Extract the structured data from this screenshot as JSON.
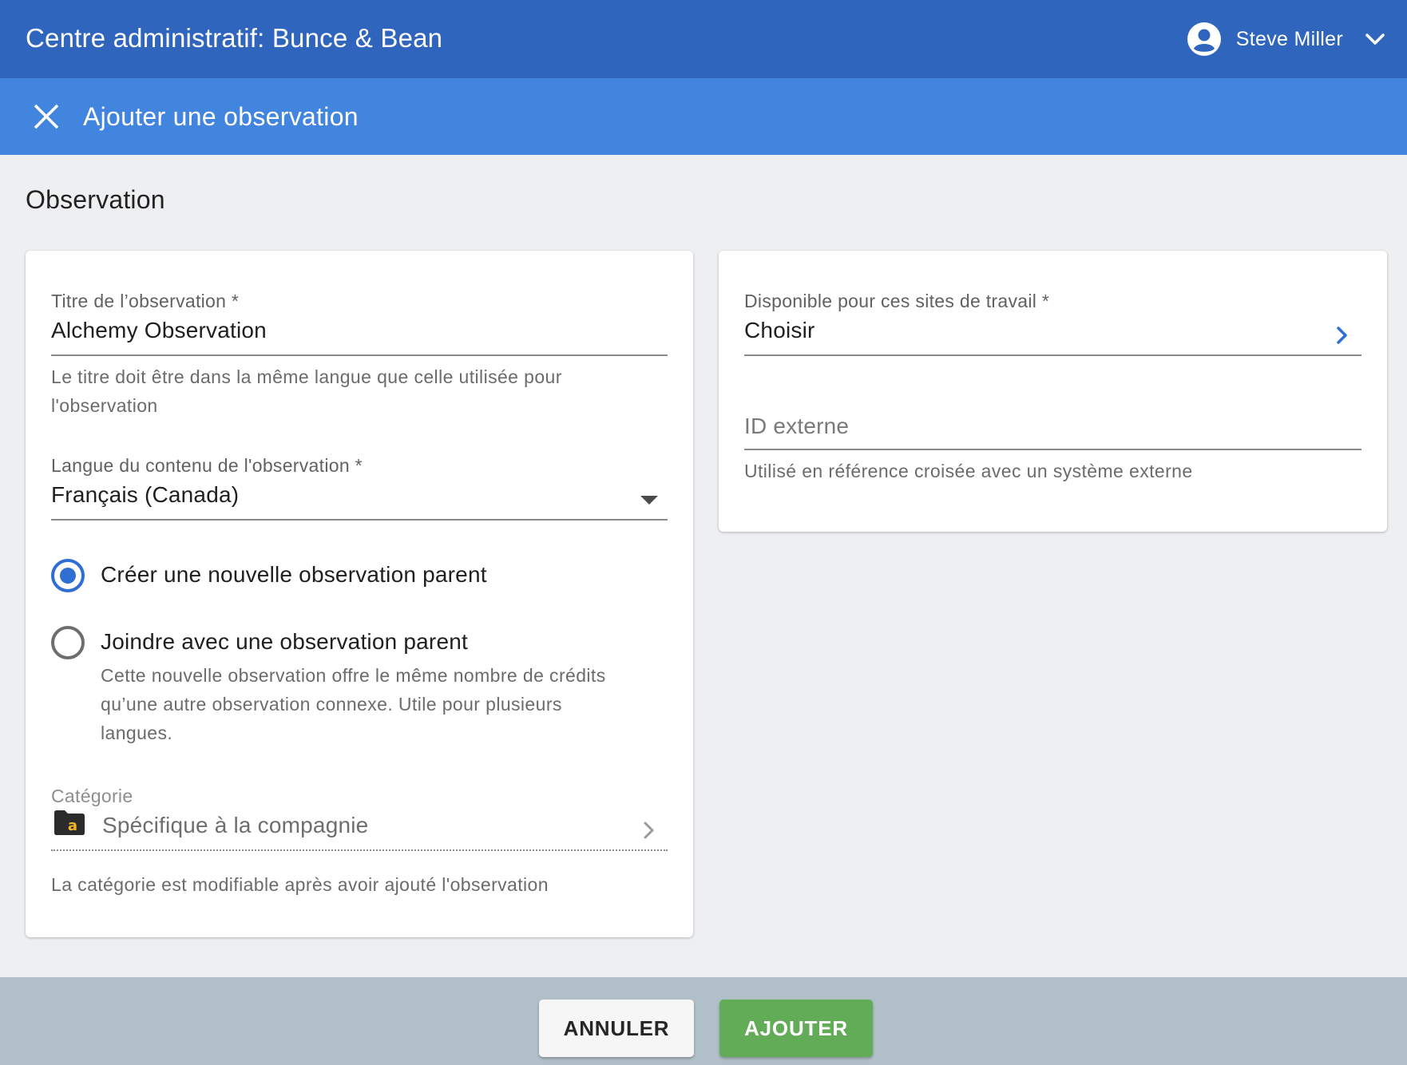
{
  "header": {
    "title": "Centre administratif: Bunce & Bean",
    "user_name": "Steve Miller"
  },
  "subheader": {
    "title": "Ajouter une observation"
  },
  "section": {
    "title": "Observation"
  },
  "form": {
    "title_field": {
      "label": "Titre de l’observation *",
      "value": "Alchemy Observation",
      "helper_line1": "Le titre doit être dans la même langue que celle utilisée pour",
      "helper_line2": "l'observation"
    },
    "language_field": {
      "label": "Langue du contenu de l'observation *",
      "value": "Français (Canada)"
    },
    "radio_options": {
      "create_label": "Créer une nouvelle observation parent",
      "join_label": "Joindre avec une observation parent",
      "join_helper_line1": "Cette nouvelle observation offre le même nombre de crédits",
      "join_helper_line2": "qu’une autre observation connexe. Utile pour plusieurs",
      "join_helper_line3": "langues.",
      "selected": "create"
    },
    "category_field": {
      "label": "Catégorie",
      "value": "Spécifique à la compagnie",
      "icon_letter": "a",
      "helper": "La catégorie est modifiable après avoir ajouté l'observation"
    },
    "sites_field": {
      "label": "Disponible pour ces sites de travail *",
      "value": "Choisir"
    },
    "external_id_field": {
      "placeholder": "ID externe",
      "helper": "Utilisé en référence croisée avec un système externe"
    }
  },
  "footer": {
    "cancel_label": "ANNULER",
    "add_label": "AJOUTER"
  },
  "colors": {
    "appbar": "#2f65bc",
    "subbar": "#4285de",
    "radio_accent": "#2f6ed3",
    "add_button": "#63ac57",
    "footer": "#b1bfc8"
  },
  "icons": {
    "close": "close-icon",
    "user": "account-circle-icon",
    "user_menu": "chevron-down-icon",
    "dropdown": "caret-down-icon",
    "sites_nav": "chevron-right-icon",
    "category_nav": "chevron-right-icon",
    "category": "folder-icon"
  }
}
